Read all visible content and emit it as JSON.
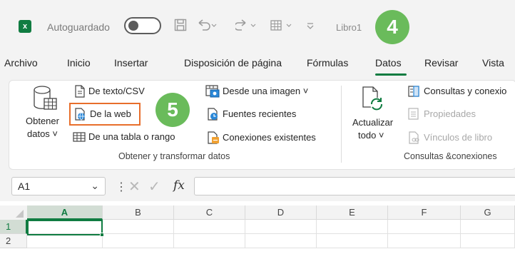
{
  "titlebar": {
    "app_icon_letter": "x",
    "autosave_label": "Autoguardado",
    "doc_title": "Libro1",
    "step_badge_4": "4"
  },
  "tabs": [
    "Archivo",
    "Inicio",
    "Insertar",
    "Disposición de página",
    "Fórmulas",
    "Datos",
    "Revisar",
    "Vista"
  ],
  "active_tab": "Datos",
  "ribbon": {
    "get_data": {
      "line1": "Obtener",
      "line2": "datos ˅"
    },
    "from_text_csv": "De texto/CSV",
    "from_web": "De la web",
    "from_table_range": "De una tabla o rango",
    "from_image": "Desde una imagen ˅",
    "recent_sources": "Fuentes recientes",
    "existing_connections": "Conexiones existentes",
    "group1_label": "Obtener y transformar datos",
    "refresh_all": {
      "line1": "Actualizar",
      "line2": "todo ˅"
    },
    "queries_connections": "Consultas y conexio",
    "properties": "Propiedades",
    "book_links": "Vínculos de libro",
    "group2_label": "Consultas &conexiones",
    "step_badge_5": "5"
  },
  "formula_bar": {
    "name_box": "A1",
    "fx": "fx"
  },
  "grid": {
    "columns": [
      "A",
      "B",
      "C",
      "D",
      "E",
      "F",
      "G"
    ],
    "rows": [
      "1",
      "2"
    ]
  },
  "colors": {
    "excel_green": "#107c41",
    "badge_green": "#6abb5b",
    "highlight_orange": "#e86e2b"
  }
}
